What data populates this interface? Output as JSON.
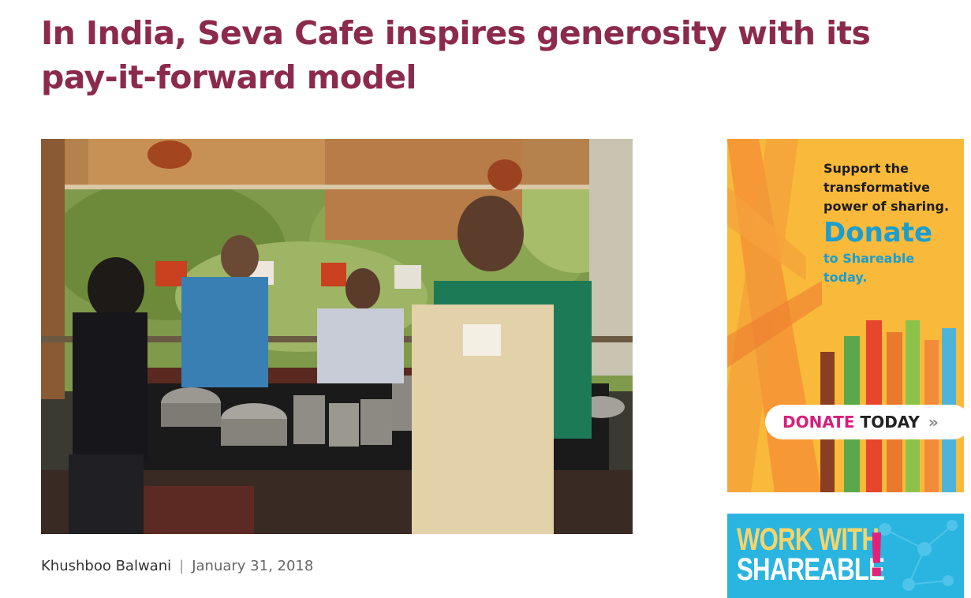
{
  "article": {
    "headline": "In India, Seva Cafe inspires generosity with its pay-it-forward model",
    "author": "Khushboo Balwani",
    "separator": "|",
    "date": "January 31, 2018"
  },
  "donate_ad": {
    "tagline_1": "Support the",
    "tagline_2": "transformative",
    "tagline_3": "power of sharing.",
    "donate_word": "Donate",
    "sub_1": "to Shareable",
    "sub_2": "today.",
    "button_part_1": "DONATE",
    "button_part_2": "TODAY",
    "button_chevron": "»",
    "colors": {
      "background": "#f9b93a",
      "accent": "#1a9ed0",
      "button_text": "#d61f7a"
    }
  },
  "work_ad": {
    "line_1": "WORK WITH",
    "line_2": "SHAREABLE",
    "exclaim": "!",
    "colors": {
      "background": "#29b5e0",
      "line_1": "#f7d46a",
      "exclaim": "#e2227a"
    }
  },
  "colors": {
    "headline": "#8c2a4d"
  }
}
